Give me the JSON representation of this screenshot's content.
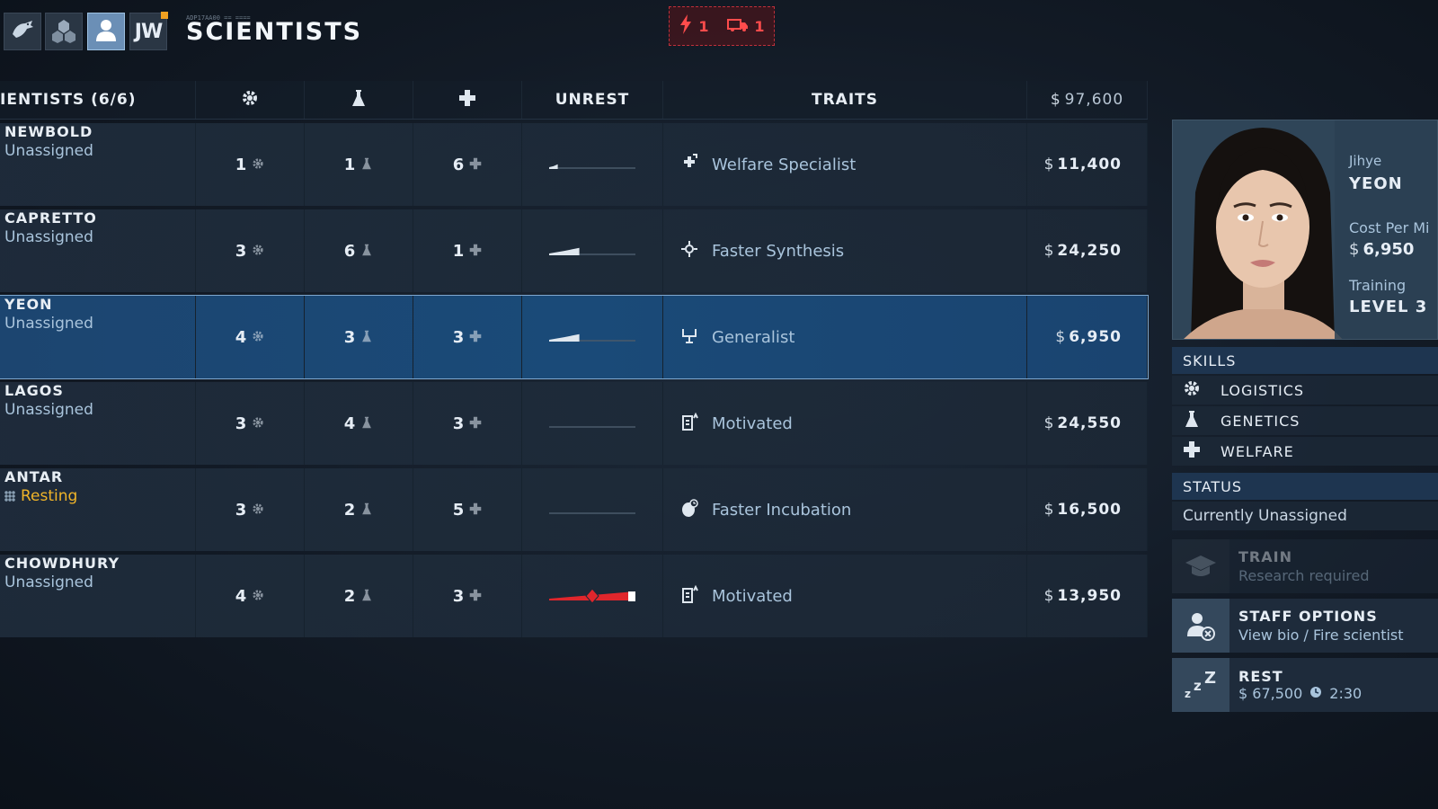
{
  "topbar": {
    "tabs": [
      {
        "name": "dinosaur-tab",
        "icon": "dinosaur-icon"
      },
      {
        "name": "molecule-tab",
        "icon": "molecule-icon"
      },
      {
        "name": "scientists-tab",
        "icon": "person-icon",
        "active": true
      },
      {
        "name": "jw-tab",
        "label": "JW"
      }
    ],
    "tiny_code": "ADP17AA00  ==  ====",
    "title": "SCIENTISTS",
    "alerts": [
      {
        "icon": "power-icon",
        "count": "1"
      },
      {
        "icon": "transport-icon",
        "count": "1"
      }
    ]
  },
  "table": {
    "header": {
      "name": "IENTISTS (6/6)",
      "logistics_icon": "gear-icon",
      "genetics_icon": "flask-icon",
      "welfare_icon": "cross-icon",
      "unrest": "UNREST",
      "traits": "TRAITS",
      "total_symbol": "$",
      "total": "97,600"
    },
    "rows": [
      {
        "name": "NEWBOLD",
        "status": "Unassigned",
        "logistics": "1",
        "genetics": "1",
        "welfare": "6",
        "unrest": 0.1,
        "trait": "Welfare Specialist",
        "trait_icon": "welfare-specialist-icon",
        "cost": "11,400"
      },
      {
        "name": "CAPRETTO",
        "status": "Unassigned",
        "logistics": "3",
        "genetics": "6",
        "welfare": "1",
        "unrest": 0.35,
        "trait": "Faster Synthesis",
        "trait_icon": "synthesis-icon",
        "cost": "24,250"
      },
      {
        "name": "YEON",
        "status": "Unassigned",
        "logistics": "4",
        "genetics": "3",
        "welfare": "3",
        "unrest": 0.35,
        "trait": "Generalist",
        "trait_icon": "generalist-icon",
        "cost": "6,950",
        "selected": true
      },
      {
        "name": "LAGOS",
        "status": "Unassigned",
        "logistics": "3",
        "genetics": "4",
        "welfare": "3",
        "unrest": 0,
        "trait": "Motivated",
        "trait_icon": "motivated-icon",
        "cost": "24,550"
      },
      {
        "name": "ANTAR",
        "status": "Resting",
        "logistics": "3",
        "genetics": "2",
        "welfare": "5",
        "unrest": 0,
        "trait": "Faster Incubation",
        "trait_icon": "incubation-icon",
        "cost": "16,500",
        "resting": true
      },
      {
        "name": "CHOWDHURY",
        "status": "Unassigned",
        "logistics": "4",
        "genetics": "2",
        "welfare": "3",
        "unrest": 1.0,
        "trait": "Motivated",
        "trait_icon": "motivated-icon",
        "cost": "13,950",
        "warning": true
      }
    ],
    "currency": "$"
  },
  "panel": {
    "first_name": "Jihye",
    "last_name": "YEON",
    "cost_label": "Cost Per Mi",
    "cost_symbol": "$",
    "cost": "6,950",
    "training_label": "Training",
    "level": "LEVEL 3",
    "skills_head": "SKILLS",
    "skills": [
      {
        "label": "LOGISTICS",
        "icon": "gear-icon"
      },
      {
        "label": "GENETICS",
        "icon": "flask-icon"
      },
      {
        "label": "WELFARE",
        "icon": "cross-icon"
      }
    ],
    "status_head": "STATUS",
    "status_text": "Currently Unassigned",
    "train": {
      "title": "TRAIN",
      "sub": "Research required"
    },
    "staff": {
      "title": "STAFF OPTIONS",
      "sub": "View bio / Fire scientist"
    },
    "rest": {
      "title": "REST",
      "symbol": "$",
      "cost": "67,500",
      "time": "2:30"
    }
  },
  "colors": {
    "accent": "#6b8fb6",
    "selected_row": "#1a4a78",
    "alert": "#ff4c4c",
    "resting": "#f0b429"
  }
}
